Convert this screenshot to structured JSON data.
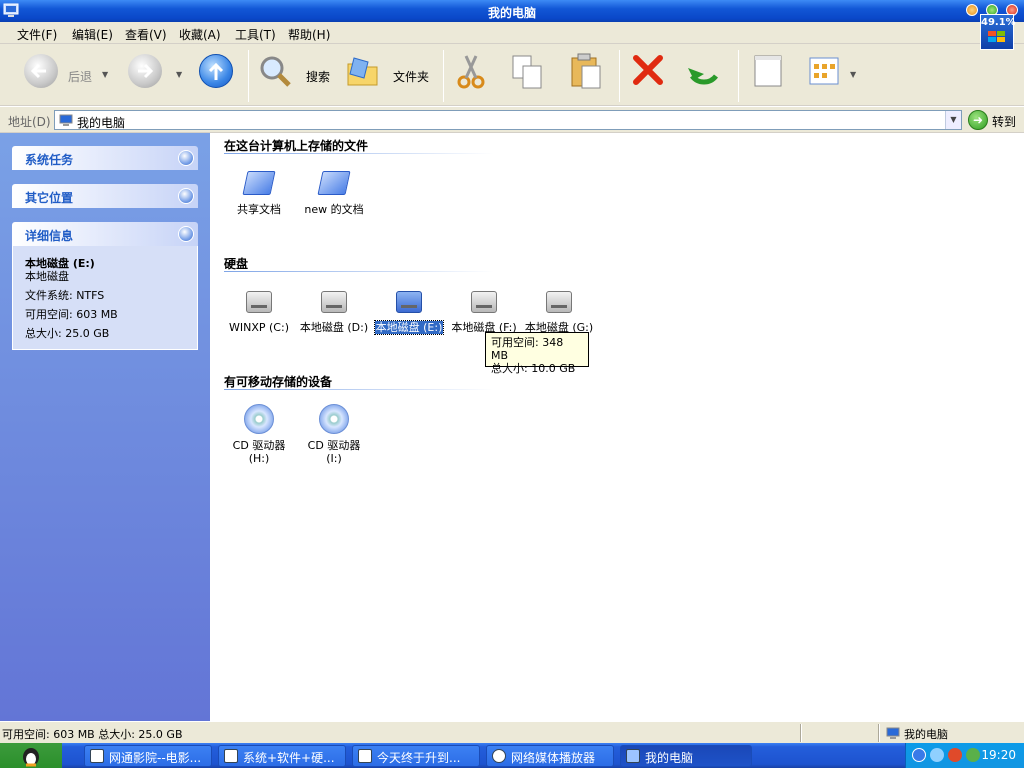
{
  "window": {
    "title": "我的电脑"
  },
  "cpu_widget": {
    "value": "49.1%"
  },
  "menu": {
    "items": [
      "文件(F)",
      "编辑(E)",
      "查看(V)",
      "收藏(A)",
      "工具(T)",
      "帮助(H)"
    ]
  },
  "toolbar": {
    "back_label": "后退",
    "search_label": "搜索",
    "folders_label": "文件夹"
  },
  "address": {
    "label": "地址(D)",
    "value": "我的电脑",
    "go_label": "转到"
  },
  "sidebar": {
    "system_tasks": "系统任务",
    "other_places": "其它位置",
    "details": {
      "title": "详细信息",
      "name": "本地磁盘 (E:)",
      "type": "本地磁盘",
      "filesystem": "文件系统: NTFS",
      "free": "可用空间: 603 MB",
      "total": "总大小: 25.0 GB"
    }
  },
  "groups": {
    "files": {
      "title": "在这台计算机上存储的文件",
      "items": [
        "共享文档",
        "new 的文档"
      ]
    },
    "drives": {
      "title": "硬盘",
      "items": [
        "WINXP (C:)",
        "本地磁盘 (D:)",
        "本地磁盘 (E:)",
        "本地磁盘 (F:)",
        "本地磁盘 (G:)"
      ]
    },
    "removable": {
      "title": "有可移动存储的设备",
      "items": [
        {
          "line1": "CD 驱动器",
          "line2": "(H:)"
        },
        {
          "line1": "CD 驱动器",
          "line2": "(I:)"
        }
      ]
    }
  },
  "tooltip": {
    "line1": "可用空间: 348 MB",
    "line2": "总大小: 10.0 GB"
  },
  "status": {
    "left": "可用空间: 603 MB 总大小: 25.0 GB",
    "right": "我的电脑"
  },
  "taskbar": {
    "tasks": [
      "网通影院--电影...",
      "系统+软件+硬...",
      "今天终于升到...",
      "网络媒体播放器",
      "我的电脑"
    ],
    "clock": "19:20"
  }
}
